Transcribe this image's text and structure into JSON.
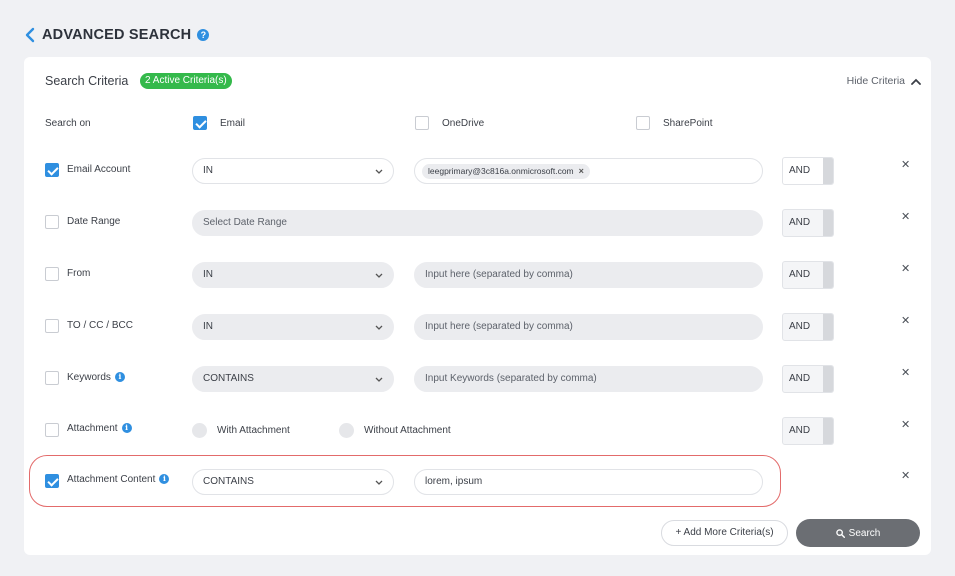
{
  "header": {
    "title": "ADVANCED SEARCH",
    "help_glyph": "?"
  },
  "panel": {
    "title": "Search Criteria",
    "active_badge": "2 Active Criteria(s)",
    "hide_label": "Hide Criteria"
  },
  "search_on": {
    "label": "Search on",
    "options": [
      {
        "label": "Email",
        "checked": true
      },
      {
        "label": "OneDrive",
        "checked": false
      },
      {
        "label": "SharePoint",
        "checked": false
      }
    ]
  },
  "criteria": {
    "email_account": {
      "label": "Email Account",
      "checked": true,
      "operator": "IN",
      "value_chip": "leegprimary@3c816a.onmicrosoft.com",
      "logic": "AND"
    },
    "date_range": {
      "label": "Date Range",
      "checked": false,
      "placeholder": "Select Date Range",
      "logic": "AND"
    },
    "from": {
      "label": "From",
      "checked": false,
      "operator": "IN",
      "placeholder": "Input here (separated by comma)",
      "logic": "AND"
    },
    "to_cc_bcc": {
      "label": "TO / CC / BCC",
      "checked": false,
      "operator": "IN",
      "placeholder": "Input here (separated by comma)",
      "logic": "AND"
    },
    "keywords": {
      "label": "Keywords",
      "checked": false,
      "operator": "CONTAINS",
      "placeholder": "Input Keywords (separated by comma)",
      "logic": "AND"
    },
    "attachment": {
      "label": "Attachment",
      "checked": false,
      "option_with": "With Attachment",
      "option_without": "Without Attachment",
      "logic": "AND"
    },
    "attachment_content": {
      "label": "Attachment Content",
      "checked": true,
      "operator": "CONTAINS",
      "value": "lorem, ipsum"
    }
  },
  "actions": {
    "add_more": "+ Add More Criteria(s)",
    "search": "Search"
  },
  "colors": {
    "accent": "#2f8fe0",
    "badge_green": "#34b94b",
    "highlight_red": "#e36b6b",
    "search_button": "#6b6e73"
  },
  "icons": {
    "back": "chevron-left-icon",
    "help": "question-circle-icon",
    "collapse": "chevron-up-icon",
    "dropdown": "chevron-down-icon",
    "info": "info-circle-icon",
    "remove": "close-icon",
    "search": "search-icon"
  }
}
